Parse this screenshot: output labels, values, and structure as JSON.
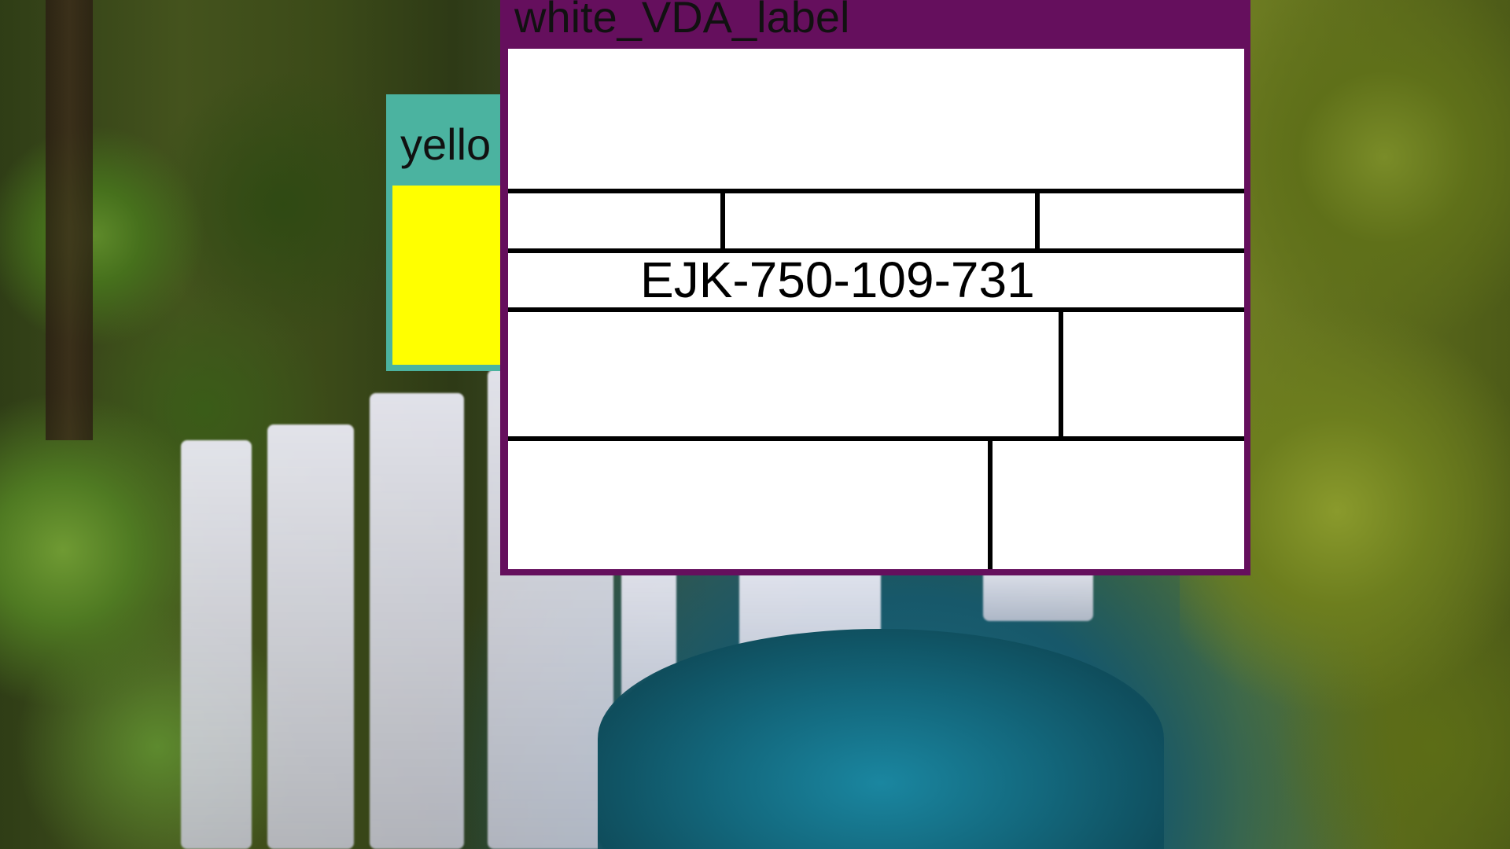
{
  "background": {
    "scene": "waterfall-forest"
  },
  "yellow_label": {
    "header_text": "yello",
    "color": "#ffff00",
    "frame_color": "#4bb3a0"
  },
  "white_label": {
    "header_text": "white_VDA_label",
    "code": "EJK-750-109-731",
    "frame_color": "#650f5d"
  }
}
